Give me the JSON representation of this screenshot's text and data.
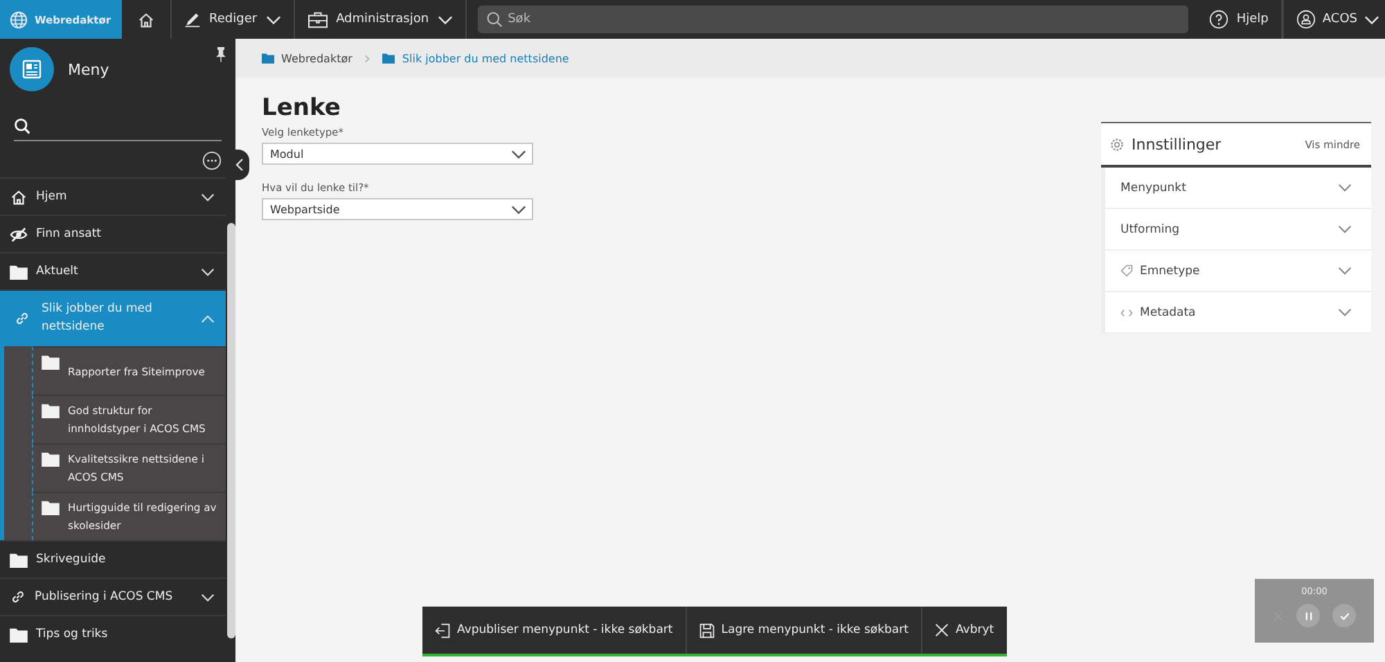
{
  "topbar": {
    "app": {
      "label": "Webredaktør",
      "selected": true
    },
    "menus": [
      {
        "kind": "edit",
        "label": "Rediger"
      },
      {
        "kind": "admin",
        "label": "Administrasjon"
      }
    ],
    "search": {
      "placeholder": "Søk"
    },
    "help": "Hjelp",
    "user": "ACOS"
  },
  "sidebar": {
    "title": "Meny",
    "items": [
      {
        "kind": "home",
        "label": "Hjem",
        "selected": false,
        "expanded": false
      },
      {
        "kind": "hidden",
        "label": "Finn ansatt",
        "selected": false
      },
      {
        "kind": "folder",
        "label": "Aktuelt",
        "selected": false,
        "expanded": false
      },
      {
        "kind": "link",
        "label": "Slik jobber du med nettsidene",
        "selected": true,
        "expanded": true,
        "children": [
          {
            "kind": "folder",
            "label": "Rapporter fra Siteimprove",
            "selected": false
          },
          {
            "kind": "folder",
            "label": "God struktur for innholdstyper i ACOS CMS",
            "selected": false
          },
          {
            "kind": "folder",
            "label": "Kvalitetssikre nettsidene i ACOS CMS",
            "selected": false
          },
          {
            "kind": "folder",
            "label": "Hurtigguide til redigering av skolesider",
            "selected": false
          }
        ]
      },
      {
        "kind": "folder",
        "label": "Skriveguide",
        "selected": false
      },
      {
        "kind": "link",
        "label": "Publisering i ACOS CMS",
        "selected": false,
        "expanded": false
      },
      {
        "kind": "folder",
        "label": "Tips og triks",
        "selected": false
      }
    ]
  },
  "breadcrumb": [
    "Webredaktør",
    "Slik jobber du med nettsidene"
  ],
  "form": {
    "title": "Lenke",
    "fields": [
      {
        "label": "Velg lenketype*",
        "value": "Modul"
      },
      {
        "label": "Hva vil du lenke til?*",
        "value": "Webpartside"
      }
    ]
  },
  "settings": {
    "title": "Innstillinger",
    "toggle": "Vis mindre",
    "sections": [
      {
        "kind": "plain",
        "label": "Menypunkt",
        "expanded": false
      },
      {
        "kind": "plain",
        "label": "Utforming",
        "expanded": false
      },
      {
        "kind": "tag",
        "label": "Emnetype",
        "expanded": false
      },
      {
        "kind": "code",
        "label": "Metadata",
        "expanded": false
      }
    ]
  },
  "actions": [
    {
      "kind": "unpublish",
      "label": "Avpubliser menypunkt - ikke søkbart"
    },
    {
      "kind": "save",
      "label": "Lagre menypunkt - ikke søkbart"
    },
    {
      "kind": "cancel",
      "label": "Avbryt"
    }
  ],
  "recorder": {
    "time": "00:00"
  }
}
